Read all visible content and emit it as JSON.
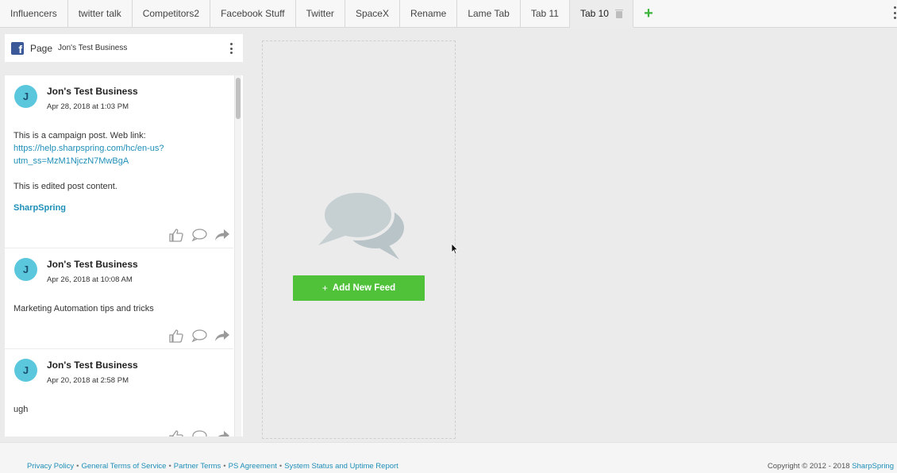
{
  "tabs": [
    {
      "label": "Influencers"
    },
    {
      "label": "twitter talk"
    },
    {
      "label": "Competitors2"
    },
    {
      "label": "Facebook Stuff"
    },
    {
      "label": "Twitter"
    },
    {
      "label": "SpaceX"
    },
    {
      "label": "Rename"
    },
    {
      "label": "Lame Tab"
    },
    {
      "label": "Tab 11"
    },
    {
      "label": "Tab 10",
      "active": true
    }
  ],
  "add_tab_label": "+",
  "feed": {
    "network_icon": "facebook-icon",
    "type": "Page",
    "name": "Jon's Test Business",
    "posts": [
      {
        "avatar_letter": "J",
        "author": "Jon's Test Business",
        "date": "Apr 28, 2018 at 1:03 PM",
        "text_line1": "This is a campaign post. Web link:",
        "link_line1": "https://help.sharpspring.com/hc/en-us?",
        "link_line2": "utm_ss=MzM1NjczN7MwBgA",
        "text_line2": "This is edited post content.",
        "brand": "SharpSpring"
      },
      {
        "avatar_letter": "J",
        "author": "Jon's Test Business",
        "date": "Apr 26, 2018 at 10:08 AM",
        "text_line1": "Marketing Automation tips and tricks"
      },
      {
        "avatar_letter": "J",
        "author": "Jon's Test Business",
        "date": "Apr 20, 2018 at 2:58 PM",
        "text_line1": "ugh"
      }
    ],
    "action_icons": [
      "like-icon",
      "comment-icon",
      "share-icon"
    ]
  },
  "empty_column": {
    "icon": "chat-bubbles-icon",
    "add_button_label": "Add New Feed"
  },
  "footer": {
    "links": [
      "Privacy Policy",
      "General Terms of Service",
      "Partner Terms",
      "PS Agreement",
      "System Status and Uptime Report"
    ],
    "separator": "•",
    "copyright": "Copyright © 2012 - 2018",
    "brand_link": "SharpSpring"
  },
  "colors": {
    "accent": "#1f8fb8",
    "add_button": "#4fc23a",
    "avatar": "#5bc7dd",
    "facebook": "#3b5998"
  }
}
